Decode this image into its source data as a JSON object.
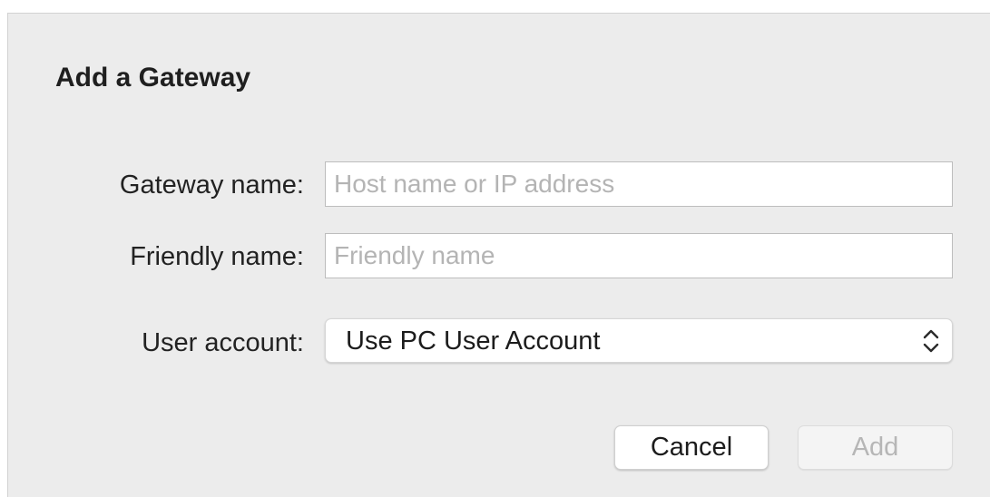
{
  "dialog": {
    "title": "Add a Gateway"
  },
  "form": {
    "gateway_name": {
      "label": "Gateway name:",
      "value": "",
      "placeholder": "Host name or IP address"
    },
    "friendly_name": {
      "label": "Friendly name:",
      "value": "",
      "placeholder": "Friendly name"
    },
    "user_account": {
      "label": "User account:",
      "selected": "Use PC User Account",
      "icon": "chevron-up-down-icon"
    }
  },
  "buttons": {
    "cancel_label": "Cancel",
    "add_label": "Add",
    "add_enabled": false
  },
  "colors": {
    "dialog_background": "#ececec",
    "placeholder_text": "#b4b4b4",
    "disabled_text": "#b6b6b6"
  }
}
